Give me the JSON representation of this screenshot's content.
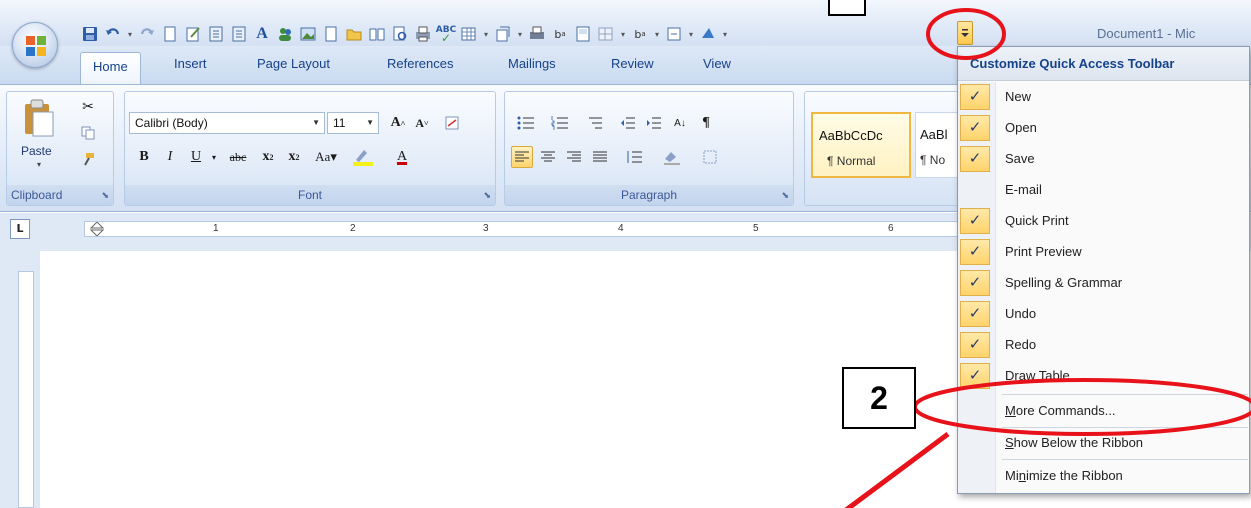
{
  "window": {
    "title": "Document1 - Mic"
  },
  "quick_access": {
    "icons": [
      "save-icon",
      "undo-icon",
      "redo-icon",
      "new-icon",
      "edit-icon",
      "list-icon",
      "list-icon-2",
      "font-a-icon",
      "people-icon",
      "picture-icon",
      "page-icon",
      "open-icon",
      "book-icon",
      "print-preview-icon",
      "quick-print-icon",
      "spelling-icon",
      "table-icon",
      "format-icon",
      "printer-icon",
      "subscript-icon",
      "page2-icon",
      "grid-icon",
      "formula-icon",
      "box-icon",
      "fill-icon",
      "more-icon"
    ]
  },
  "tabs": [
    {
      "label": "Home",
      "active": true
    },
    {
      "label": "Insert"
    },
    {
      "label": "Page Layout"
    },
    {
      "label": "References"
    },
    {
      "label": "Mailings"
    },
    {
      "label": "Review"
    },
    {
      "label": "View"
    }
  ],
  "ribbon": {
    "clipboard": {
      "paste_label": "Paste",
      "group_label": "Clipboard"
    },
    "font": {
      "font_name": "Calibri (Body)",
      "font_size": "11",
      "group_label": "Font"
    },
    "paragraph": {
      "group_label": "Paragraph"
    },
    "styles": {
      "normal_preview": "AaBbCcDc",
      "normal_label": "¶ Normal",
      "nospace_preview": "AaBl",
      "nospace_label": "¶ No"
    }
  },
  "ruler": {
    "numbers": [
      "1",
      "2",
      "3",
      "4",
      "5",
      "6"
    ]
  },
  "menu": {
    "title": "Customize Quick Access Toolbar",
    "items": [
      {
        "label": "New",
        "checked": true
      },
      {
        "label": "Open",
        "checked": true
      },
      {
        "label": "Save",
        "checked": true
      },
      {
        "label": "E-mail",
        "checked": false
      },
      {
        "label": "Quick Print",
        "checked": true
      },
      {
        "label": "Print Preview",
        "checked": true
      },
      {
        "label": "Spelling & Grammar",
        "checked": true
      },
      {
        "label": "Undo",
        "checked": true
      },
      {
        "label": "Redo",
        "checked": true
      },
      {
        "label": "Draw Table",
        "checked": true
      }
    ],
    "more_commands": {
      "label": "More Commands..."
    },
    "show_below": {
      "label": "Show Below the Ribbon"
    },
    "minimize": {
      "label": "Minimize the Ribbon"
    }
  },
  "annotation": {
    "step_label": "2"
  },
  "colors": {
    "annotation_red": "#e8121b",
    "highlight": "#ffd36b",
    "ribbon_blue": "#15428b"
  }
}
